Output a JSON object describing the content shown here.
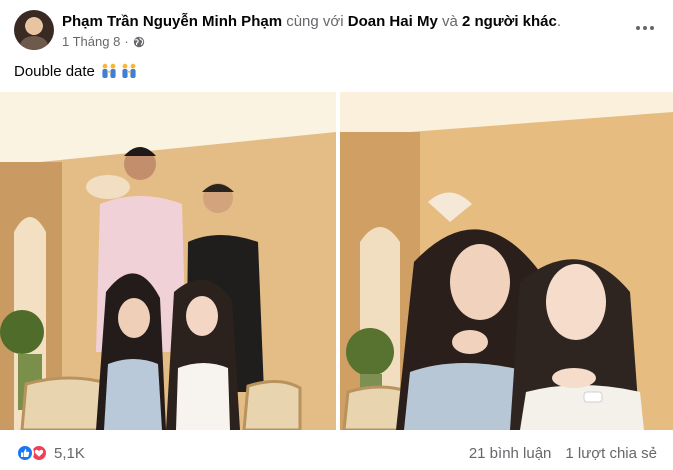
{
  "post": {
    "author": "Phạm Trần Nguyễn Minh Phạm",
    "with_text": "cùng với",
    "tagged": "Doan Hai My",
    "and_text": "và",
    "others": "2 người khác",
    "trailing": ".",
    "date": "1 Tháng 8",
    "date_separator": "·",
    "privacy_icon": "globe-icon",
    "text": "Double date",
    "text_emoji": "couple-icon"
  },
  "footer": {
    "reaction_icons": [
      "like-icon",
      "love-icon"
    ],
    "reaction_count": "5,1K",
    "comments": "21 bình luận",
    "shares": "1 lượt chia sẻ"
  },
  "colors": {
    "text_primary": "#050505",
    "text_secondary": "#65676b",
    "like_blue": "#1877f2",
    "love_red": "#f33e58"
  }
}
